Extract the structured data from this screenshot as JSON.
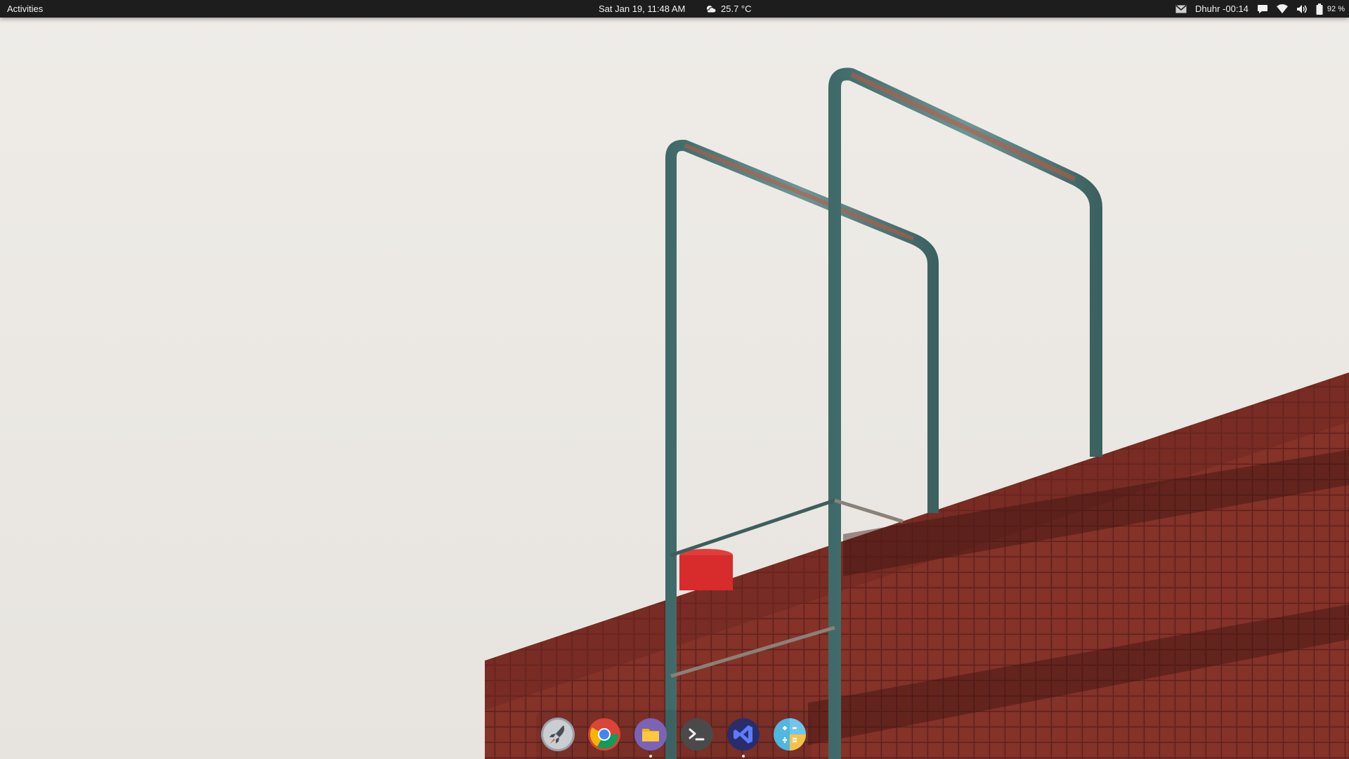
{
  "topbar": {
    "activities_label": "Activities",
    "datetime": "Sat Jan 19, 11:48 AM",
    "weather": {
      "temperature": "25.7 °C",
      "icon": "weather-cloud-sun-icon"
    },
    "prayer_time": "Dhuhr -00:14",
    "battery_percent": "92 %",
    "tray_icons": [
      "mail-icon",
      "chat-icon",
      "wifi-icon",
      "volume-icon",
      "battery-icon"
    ]
  },
  "dock": {
    "items": [
      {
        "name": "launcher",
        "icon": "rocket-icon",
        "running": false
      },
      {
        "name": "chrome",
        "icon": "chrome-icon",
        "running": false
      },
      {
        "name": "files",
        "icon": "folder-icon",
        "running": true
      },
      {
        "name": "terminal",
        "icon": "terminal-icon",
        "running": false
      },
      {
        "name": "vscode",
        "icon": "vscode-icon",
        "running": true
      },
      {
        "name": "calculator",
        "icon": "calculator-icon",
        "running": false
      }
    ]
  },
  "colors": {
    "topbar_bg": "#1d1d1d",
    "wallpaper_sky": "#ece9e4",
    "brick": "#7a2d26",
    "rail": "#4d7a78",
    "rust": "#c4553f"
  }
}
